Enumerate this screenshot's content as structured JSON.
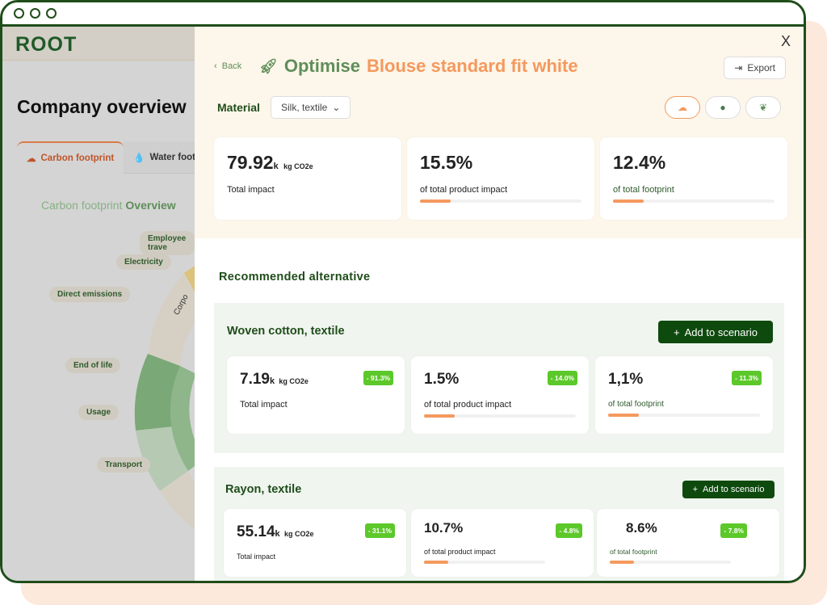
{
  "app": {
    "logo": "ROOT"
  },
  "background": {
    "page_title": "Company overview",
    "tabs": [
      {
        "label": "Carbon footprint",
        "icon": "cloud-icon",
        "active": true
      },
      {
        "label": "Water footp",
        "icon": "water-drop-icon",
        "active": false
      }
    ],
    "chart_title": "Carbon footprint",
    "chart_subtitle": "Overview",
    "labels": [
      "Employee trave",
      "Electricity",
      "Direct emissions",
      "End of life",
      "Usage",
      "Transport"
    ],
    "inner_label": "Corpo"
  },
  "panel": {
    "close": "X",
    "back": "Back",
    "title_action": "Optimise",
    "title_product": "Blouse standard fit white",
    "export": "Export",
    "material_label": "Material",
    "material_value": "Silk, textile",
    "impact_icons": [
      "cloud-icon",
      "water-drop-icon",
      "leaf-icon"
    ],
    "current": [
      {
        "value": "79.92",
        "unit_k": "k",
        "unit": "kg CO2e",
        "label": "Total impact"
      },
      {
        "value": "15.5%",
        "label": "of total product impact",
        "progress": 0.19
      },
      {
        "value": "12.4%",
        "label": "of total footprint",
        "progress": 0.19
      }
    ],
    "recommended_title": "Recommended alternative",
    "alternatives": [
      {
        "name": "Woven cotton, textile",
        "add": "Add to scenario",
        "cards": [
          {
            "value": "7.19",
            "unit_k": "k",
            "unit": "kg CO2e",
            "label": "Total impact",
            "badge": "- 91.3%"
          },
          {
            "value": "1.5%",
            "label": "of total product impact",
            "badge": "- 14.0%",
            "progress": 0.2
          },
          {
            "value": "1,1%",
            "label": "of total footprint",
            "badge": "- 11.3%",
            "progress": 0.2
          }
        ]
      },
      {
        "name": "Rayon, textile",
        "add": "Add to scenario",
        "cards": [
          {
            "value": "55.14",
            "unit_k": "k",
            "unit": "kg CO2e",
            "label": "Total impact",
            "badge": "- 31.1%"
          },
          {
            "value": "10.7%",
            "label": "of total product impact",
            "badge": "- 4.8%",
            "progress": 0.2
          },
          {
            "value": "8.6%",
            "label": "of total footprint",
            "badge": "- 7.8%",
            "progress": 0.2
          }
        ]
      }
    ]
  },
  "colors": {
    "brand_green": "#1f4d1a",
    "accent_orange": "#f4995e",
    "badge_green": "#5cc82a",
    "button_green": "#0e4a0e"
  }
}
